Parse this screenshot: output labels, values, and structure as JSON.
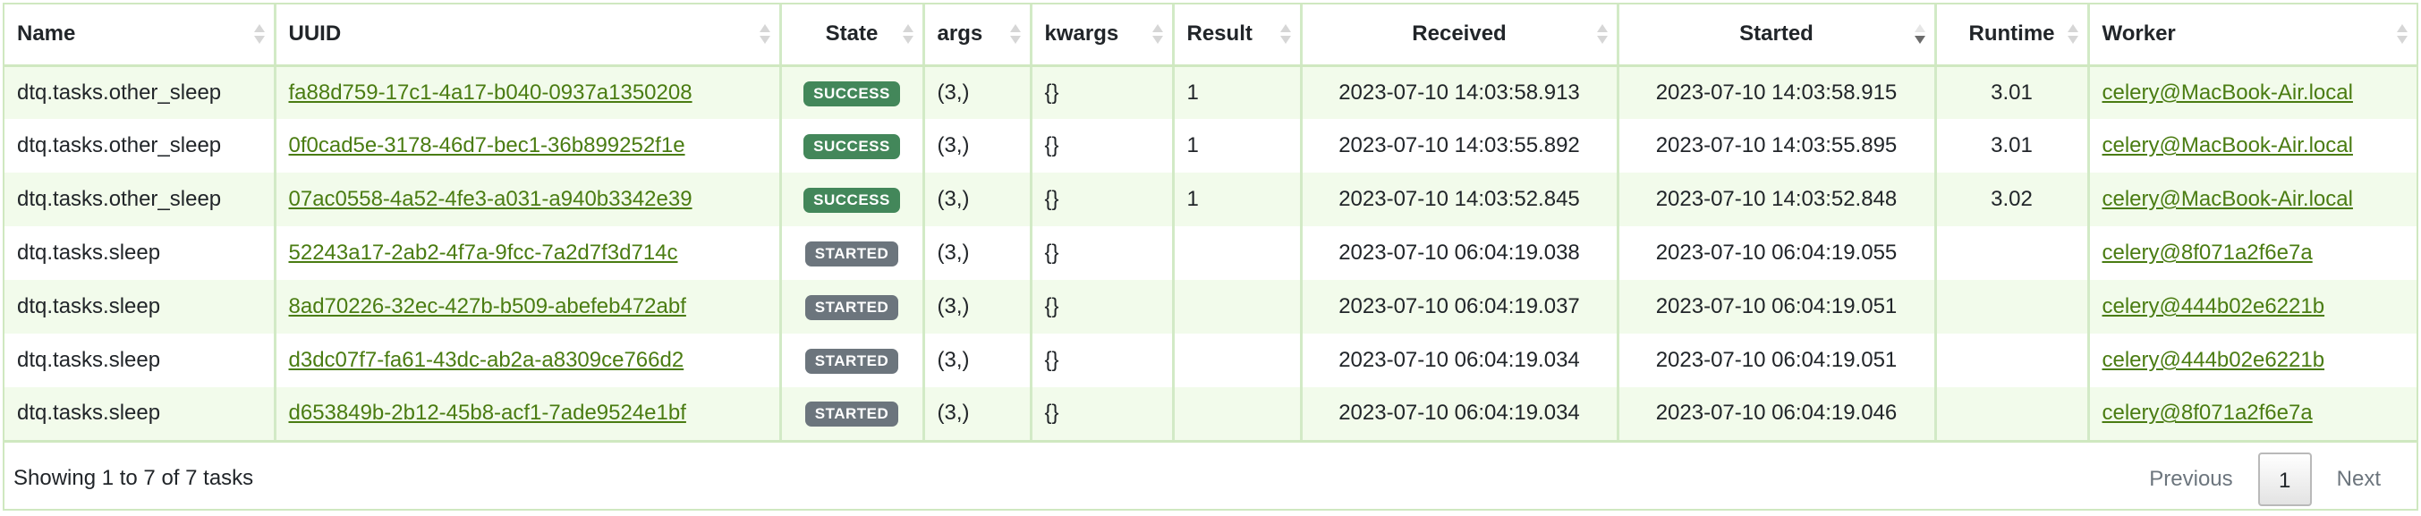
{
  "columns": [
    {
      "key": "name",
      "label": "Name"
    },
    {
      "key": "uuid",
      "label": "UUID"
    },
    {
      "key": "state",
      "label": "State"
    },
    {
      "key": "args",
      "label": "args"
    },
    {
      "key": "kwargs",
      "label": "kwargs"
    },
    {
      "key": "result",
      "label": "Result"
    },
    {
      "key": "received",
      "label": "Received"
    },
    {
      "key": "started",
      "label": "Started"
    },
    {
      "key": "runtime",
      "label": "Runtime"
    },
    {
      "key": "worker",
      "label": "Worker"
    }
  ],
  "sorted_column": "started",
  "sort_direction": "descending",
  "rows": [
    {
      "name": "dtq.tasks.other_sleep",
      "uuid": "fa88d759-17c1-4a17-b040-0937a1350208",
      "state": "SUCCESS",
      "args": "(3,)",
      "kwargs": "{}",
      "result": "1",
      "received": "2023-07-10 14:03:58.913",
      "started": "2023-07-10 14:03:58.915",
      "runtime": "3.01",
      "worker": "celery@MacBook-Air.local"
    },
    {
      "name": "dtq.tasks.other_sleep",
      "uuid": "0f0cad5e-3178-46d7-bec1-36b899252f1e",
      "state": "SUCCESS",
      "args": "(3,)",
      "kwargs": "{}",
      "result": "1",
      "received": "2023-07-10 14:03:55.892",
      "started": "2023-07-10 14:03:55.895",
      "runtime": "3.01",
      "worker": "celery@MacBook-Air.local"
    },
    {
      "name": "dtq.tasks.other_sleep",
      "uuid": "07ac0558-4a52-4fe3-a031-a940b3342e39",
      "state": "SUCCESS",
      "args": "(3,)",
      "kwargs": "{}",
      "result": "1",
      "received": "2023-07-10 14:03:52.845",
      "started": "2023-07-10 14:03:52.848",
      "runtime": "3.02",
      "worker": "celery@MacBook-Air.local"
    },
    {
      "name": "dtq.tasks.sleep",
      "uuid": "52243a17-2ab2-4f7a-9fcc-7a2d7f3d714c",
      "state": "STARTED",
      "args": "(3,)",
      "kwargs": "{}",
      "result": "",
      "received": "2023-07-10 06:04:19.038",
      "started": "2023-07-10 06:04:19.055",
      "runtime": "",
      "worker": "celery@8f071a2f6e7a"
    },
    {
      "name": "dtq.tasks.sleep",
      "uuid": "8ad70226-32ec-427b-b509-abefeb472abf",
      "state": "STARTED",
      "args": "(3,)",
      "kwargs": "{}",
      "result": "",
      "received": "2023-07-10 06:04:19.037",
      "started": "2023-07-10 06:04:19.051",
      "runtime": "",
      "worker": "celery@444b02e6221b"
    },
    {
      "name": "dtq.tasks.sleep",
      "uuid": "d3dc07f7-fa61-43dc-ab2a-a8309ce766d2",
      "state": "STARTED",
      "args": "(3,)",
      "kwargs": "{}",
      "result": "",
      "received": "2023-07-10 06:04:19.034",
      "started": "2023-07-10 06:04:19.051",
      "runtime": "",
      "worker": "celery@444b02e6221b"
    },
    {
      "name": "dtq.tasks.sleep",
      "uuid": "d653849b-2b12-45b8-acf1-7ade9524e1bf",
      "state": "STARTED",
      "args": "(3,)",
      "kwargs": "{}",
      "result": "",
      "received": "2023-07-10 06:04:19.034",
      "started": "2023-07-10 06:04:19.046",
      "runtime": "",
      "worker": "celery@8f071a2f6e7a"
    }
  ],
  "footer": {
    "info": "Showing 1 to 7 of 7 tasks",
    "previous_label": "Previous",
    "current_page": "1",
    "next_label": "Next"
  },
  "colors": {
    "accent_link": "#4a7c12",
    "success_badge": "#43875a",
    "started_badge": "#6c757d",
    "row_stripe": "#f2fbeb",
    "border": "#cfe8c0"
  }
}
